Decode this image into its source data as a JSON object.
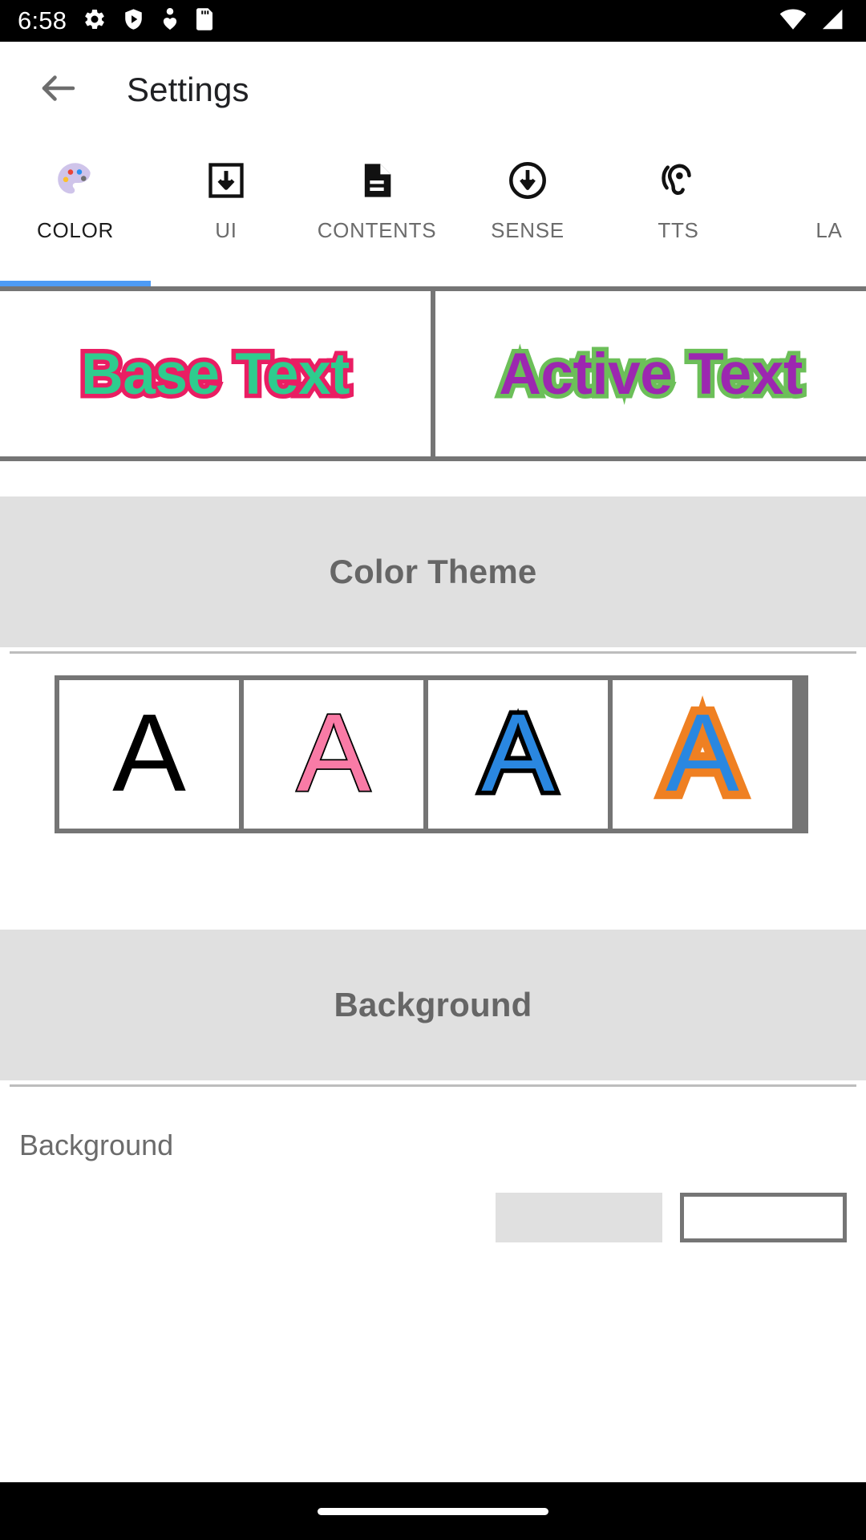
{
  "status_bar": {
    "time": "6:58",
    "left_icons": [
      "gear-icon",
      "shield-play-icon",
      "person-heart-icon",
      "sd-card-icon"
    ],
    "right_icons": [
      "wifi-icon",
      "signal-icon"
    ],
    "background_color": "#000000",
    "foreground_color": "#ffffff"
  },
  "toolbar": {
    "back_label": "",
    "title": "Settings"
  },
  "tabs": {
    "active_index": 0,
    "indicator_color": "#4d9bf5",
    "items": [
      {
        "label": "COLOR",
        "icon": "palette-icon"
      },
      {
        "label": "UI",
        "icon": "download-box-icon"
      },
      {
        "label": "CONTENTS",
        "icon": "document-icon"
      },
      {
        "label": "SENSE",
        "icon": "circle-arrow-down-icon"
      },
      {
        "label": "TTS",
        "icon": "ear-hearing-icon"
      },
      {
        "label": "LA",
        "icon": "language-icon"
      }
    ]
  },
  "preview": {
    "base": {
      "text": "Base Text",
      "fill_color": "#2ecc8e",
      "stroke_color": "#e91e63"
    },
    "active": {
      "text": "Active Text",
      "fill_color": "#9c27b0",
      "stroke_color": "#6cbf59"
    },
    "frame_color": "#757575"
  },
  "color_theme_section": {
    "header": "Color Theme",
    "header_bg": "#e0e0e0",
    "header_text_color": "#666666",
    "swatches": [
      {
        "glyph": "A",
        "fill_color": "#000000",
        "stroke_color": "#000000",
        "stroke_width": 0,
        "selected": false
      },
      {
        "glyph": "A",
        "fill_color": "#f97ba6",
        "stroke_color": "#000000",
        "stroke_width": 4,
        "selected": false
      },
      {
        "glyph": "A",
        "fill_color": "#2a87e0",
        "stroke_color": "#000000",
        "stroke_width": 13,
        "selected": false
      },
      {
        "glyph": "A",
        "fill_color": "#2a87e0",
        "stroke_color": "#ef8022",
        "stroke_width": 20,
        "selected": true
      }
    ]
  },
  "background_section": {
    "header": "Background",
    "header_bg": "#e0e0e0",
    "header_text_color": "#666666",
    "row_label": "Background",
    "swatch_filled_color": "#e0e0e0",
    "swatch_outline_color": "#ffffff"
  },
  "nav_bar": {
    "gesture_pill": "",
    "background_color": "#000000"
  }
}
